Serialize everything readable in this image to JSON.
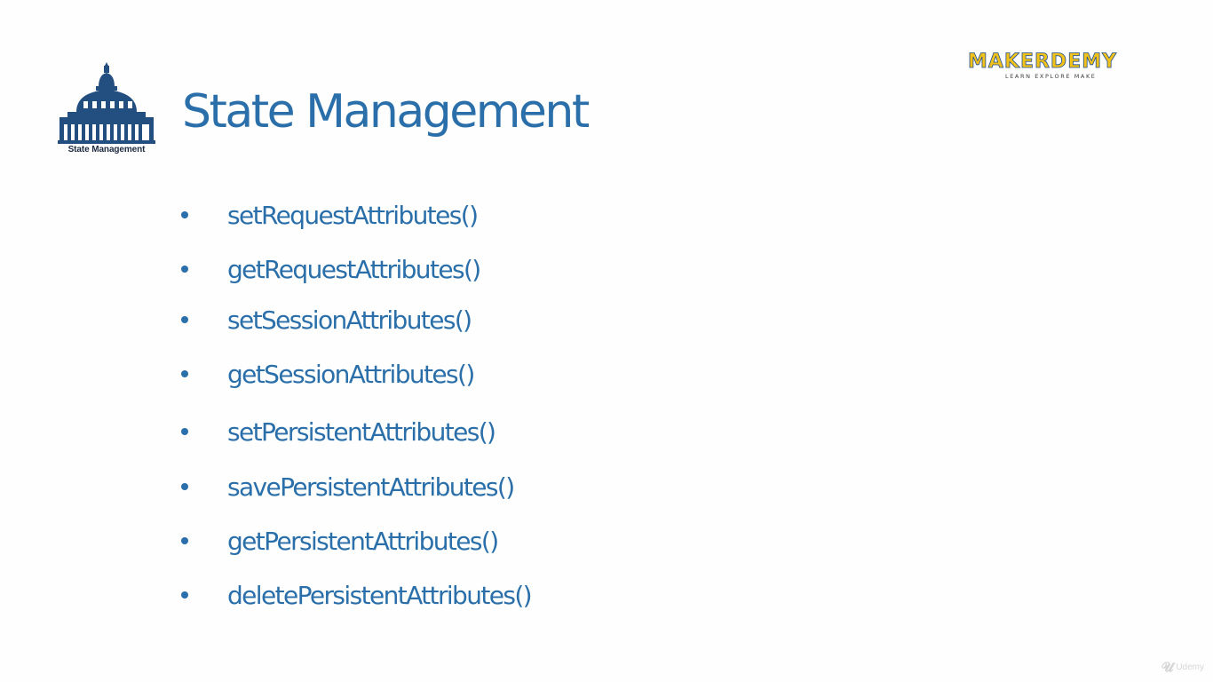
{
  "slide": {
    "title": "State Management",
    "icon_caption": "State Management",
    "logo": {
      "wordmark": "MAKERDEMY",
      "tagline": "LEARN EXPLORE MAKE"
    },
    "items": [
      "setRequestAttributes()",
      "getRequestAttributes()",
      "setSessionAttributes()",
      "getSessionAttributes()",
      "setPersistentAttributes()",
      "savePersistentAttributes()",
      "getPersistentAttributes()",
      "deletePersistentAttributes()"
    ],
    "watermark": "Udemy"
  },
  "colors": {
    "accent": "#2a6fa9",
    "icon": "#234e80",
    "logo_yellow": "#f2c11a"
  },
  "icons": {
    "header_icon": "capitol-building-icon",
    "watermark_icon": "udemy-logo-icon"
  }
}
